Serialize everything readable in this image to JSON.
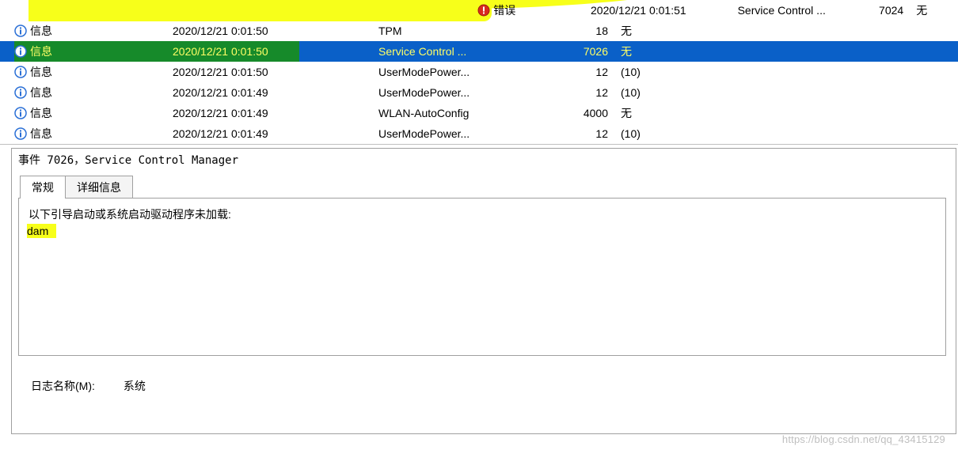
{
  "events": [
    {
      "level": "错误",
      "icon": "error",
      "date": "2020/12/21 0:01:51",
      "source": "Service Control ...",
      "id": "7024",
      "cat": "无",
      "highlight": true
    },
    {
      "level": "信息",
      "icon": "info",
      "date": "2020/12/21 0:01:50",
      "source": "TPM",
      "id": "18",
      "cat": "无"
    },
    {
      "level": "信息",
      "icon": "info",
      "date": "2020/12/21 0:01:50",
      "source": "Service Control ...",
      "id": "7026",
      "cat": "无",
      "selected": true
    },
    {
      "level": "信息",
      "icon": "info",
      "date": "2020/12/21 0:01:50",
      "source": "UserModePower...",
      "id": "12",
      "cat": "(10)"
    },
    {
      "level": "信息",
      "icon": "info",
      "date": "2020/12/21 0:01:49",
      "source": "UserModePower...",
      "id": "12",
      "cat": "(10)"
    },
    {
      "level": "信息",
      "icon": "info",
      "date": "2020/12/21 0:01:49",
      "source": "WLAN-AutoConfig",
      "id": "4000",
      "cat": "无"
    },
    {
      "level": "信息",
      "icon": "info",
      "date": "2020/12/21 0:01:49",
      "source": "UserModePower...",
      "id": "12",
      "cat": "(10)"
    }
  ],
  "details": {
    "title": "事件 7026，Service Control Manager",
    "tabs": {
      "general": "常规",
      "details": "详细信息"
    },
    "message_line1": "以下引导启动或系统启动驱动程序未加载:",
    "message_line2": "dam",
    "log_name_label": "日志名称(M):",
    "log_name_value": "系统"
  },
  "watermark": "https://blog.csdn.net/qq_43415129"
}
